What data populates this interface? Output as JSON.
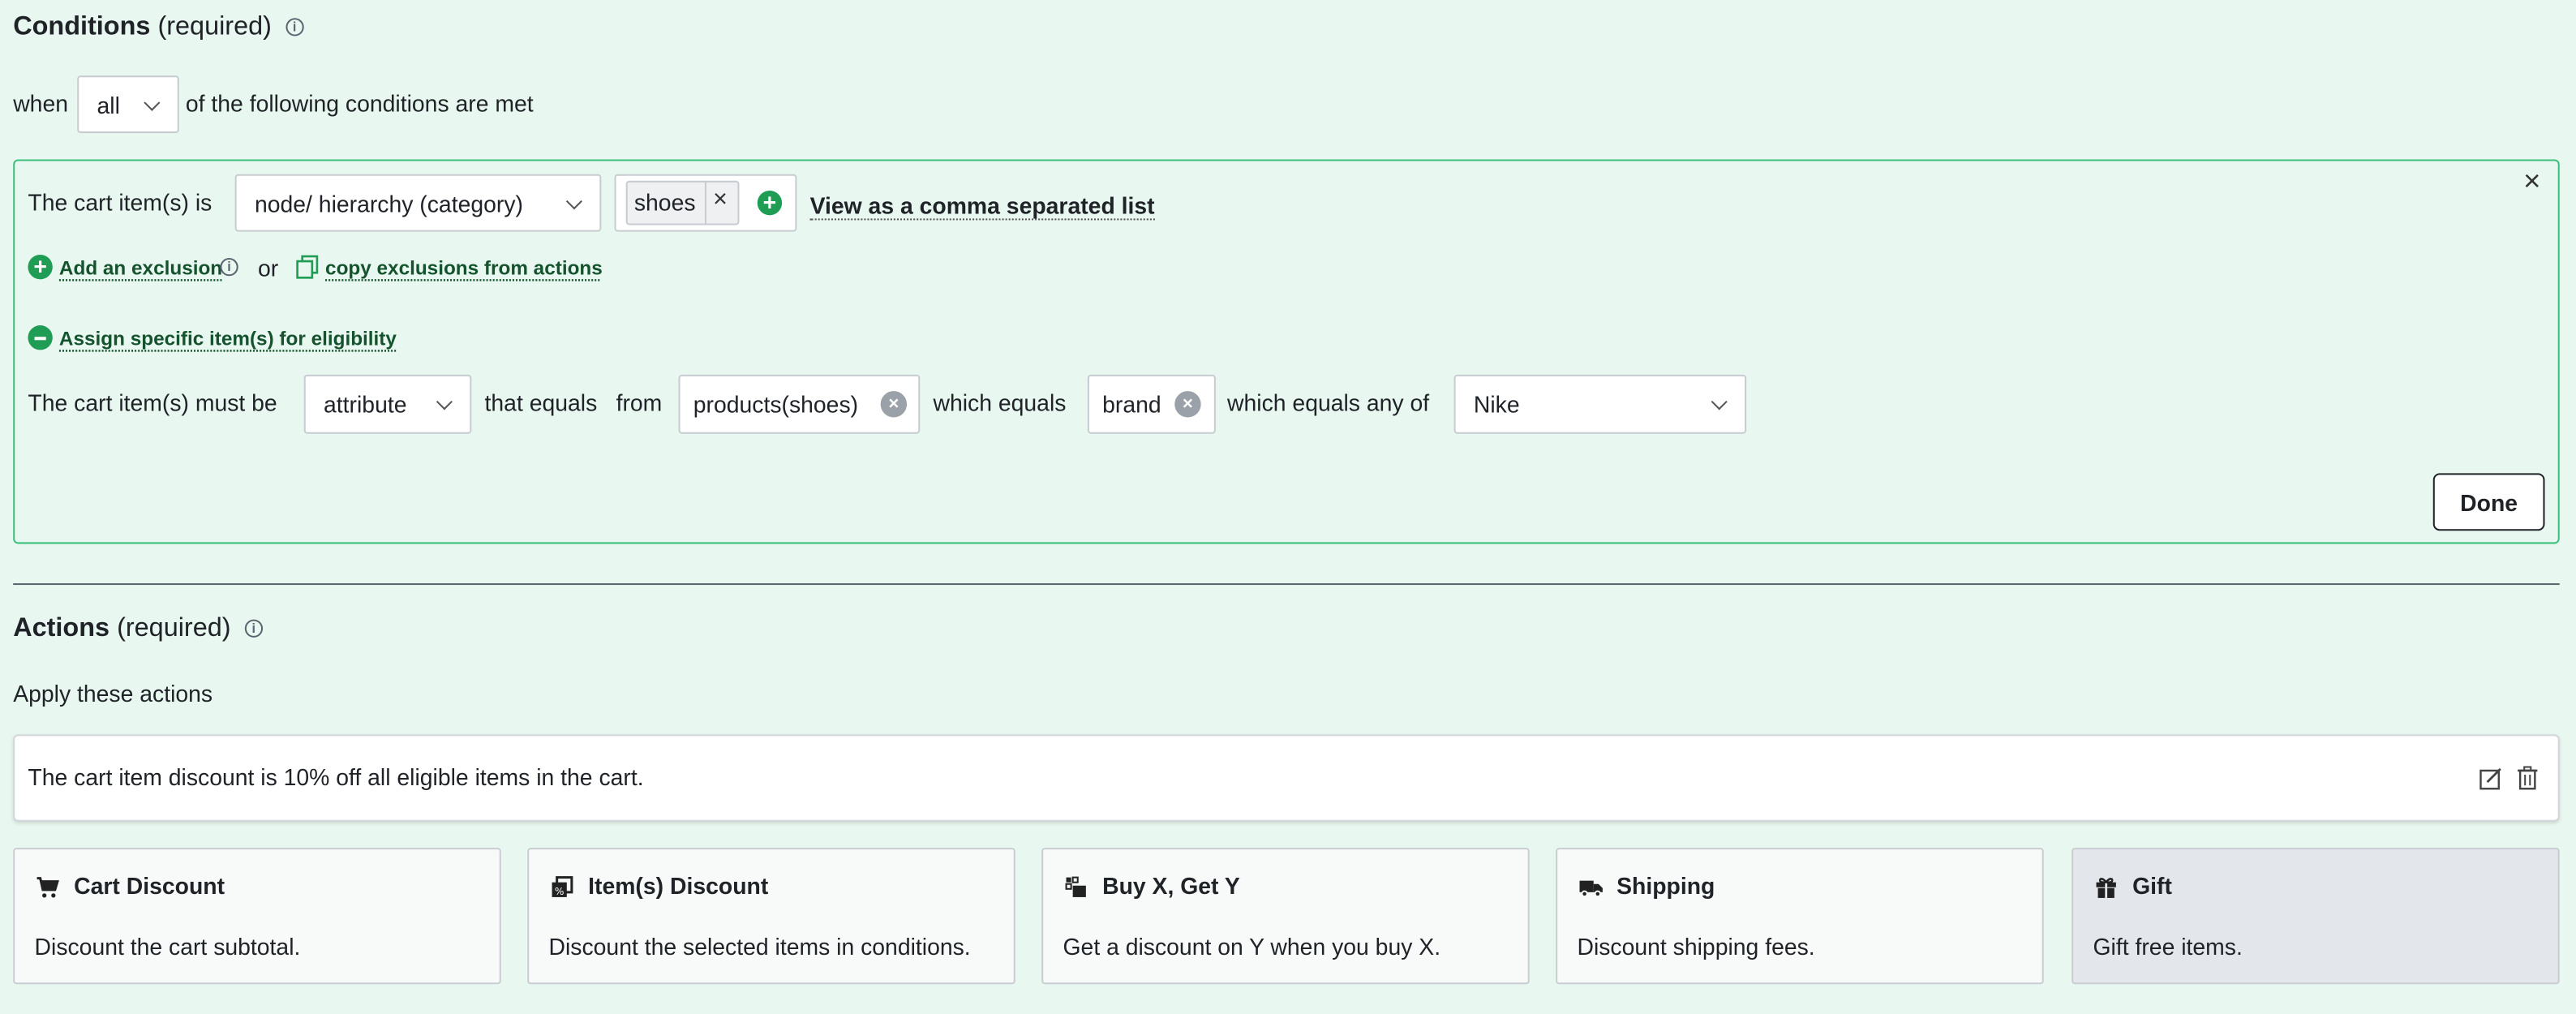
{
  "conditions": {
    "title": "Conditions",
    "required": "(required)",
    "when_label": "when",
    "match_select": "all",
    "suffix": "of the following conditions are met",
    "condition": {
      "cart_item_label": "The cart item(s) is",
      "type_select": "node/ hierarchy (category)",
      "tag": "shoes",
      "tag_remove": "×",
      "view_list_link": "View as a comma separated list",
      "add_exclusion": "Add an exclusion",
      "or_label": "or",
      "copy_exclusions": "copy exclusions from actions",
      "assign_specific": "Assign specific item(s) for eligibility",
      "must_be_label": "The cart item(s) must be",
      "attribute_select": "attribute",
      "that_equals": "that equals",
      "from_label": "from",
      "source_chip": "products(shoes)",
      "which_equals": "which equals",
      "attribute_chip": "brand",
      "which_equals_any": "which equals any of",
      "value_select": "Nike",
      "close": "×",
      "done_button": "Done"
    }
  },
  "actions": {
    "title": "Actions",
    "required": "(required)",
    "subtitle": "Apply these actions",
    "existing_action": "The cart item discount is 10% off all eligible items in the cart.",
    "cards": [
      {
        "title": "Cart Discount",
        "desc": "Discount the cart subtotal.",
        "icon": "cart-icon"
      },
      {
        "title": "Item(s) Discount",
        "desc": "Discount the selected items in conditions.",
        "icon": "items-icon"
      },
      {
        "title": "Buy X, Get Y",
        "desc": "Get a discount on Y when you buy X.",
        "icon": "buy-get-icon"
      },
      {
        "title": "Shipping",
        "desc": "Discount shipping fees.",
        "icon": "truck-icon"
      },
      {
        "title": "Gift",
        "desc": "Gift free items.",
        "icon": "gift-icon"
      }
    ]
  },
  "colors": {
    "background": "#e8f7ef",
    "accent_green": "#1f9d55",
    "border_green": "#3bbf7c",
    "gift_card_bg": "#e3e6ea"
  }
}
